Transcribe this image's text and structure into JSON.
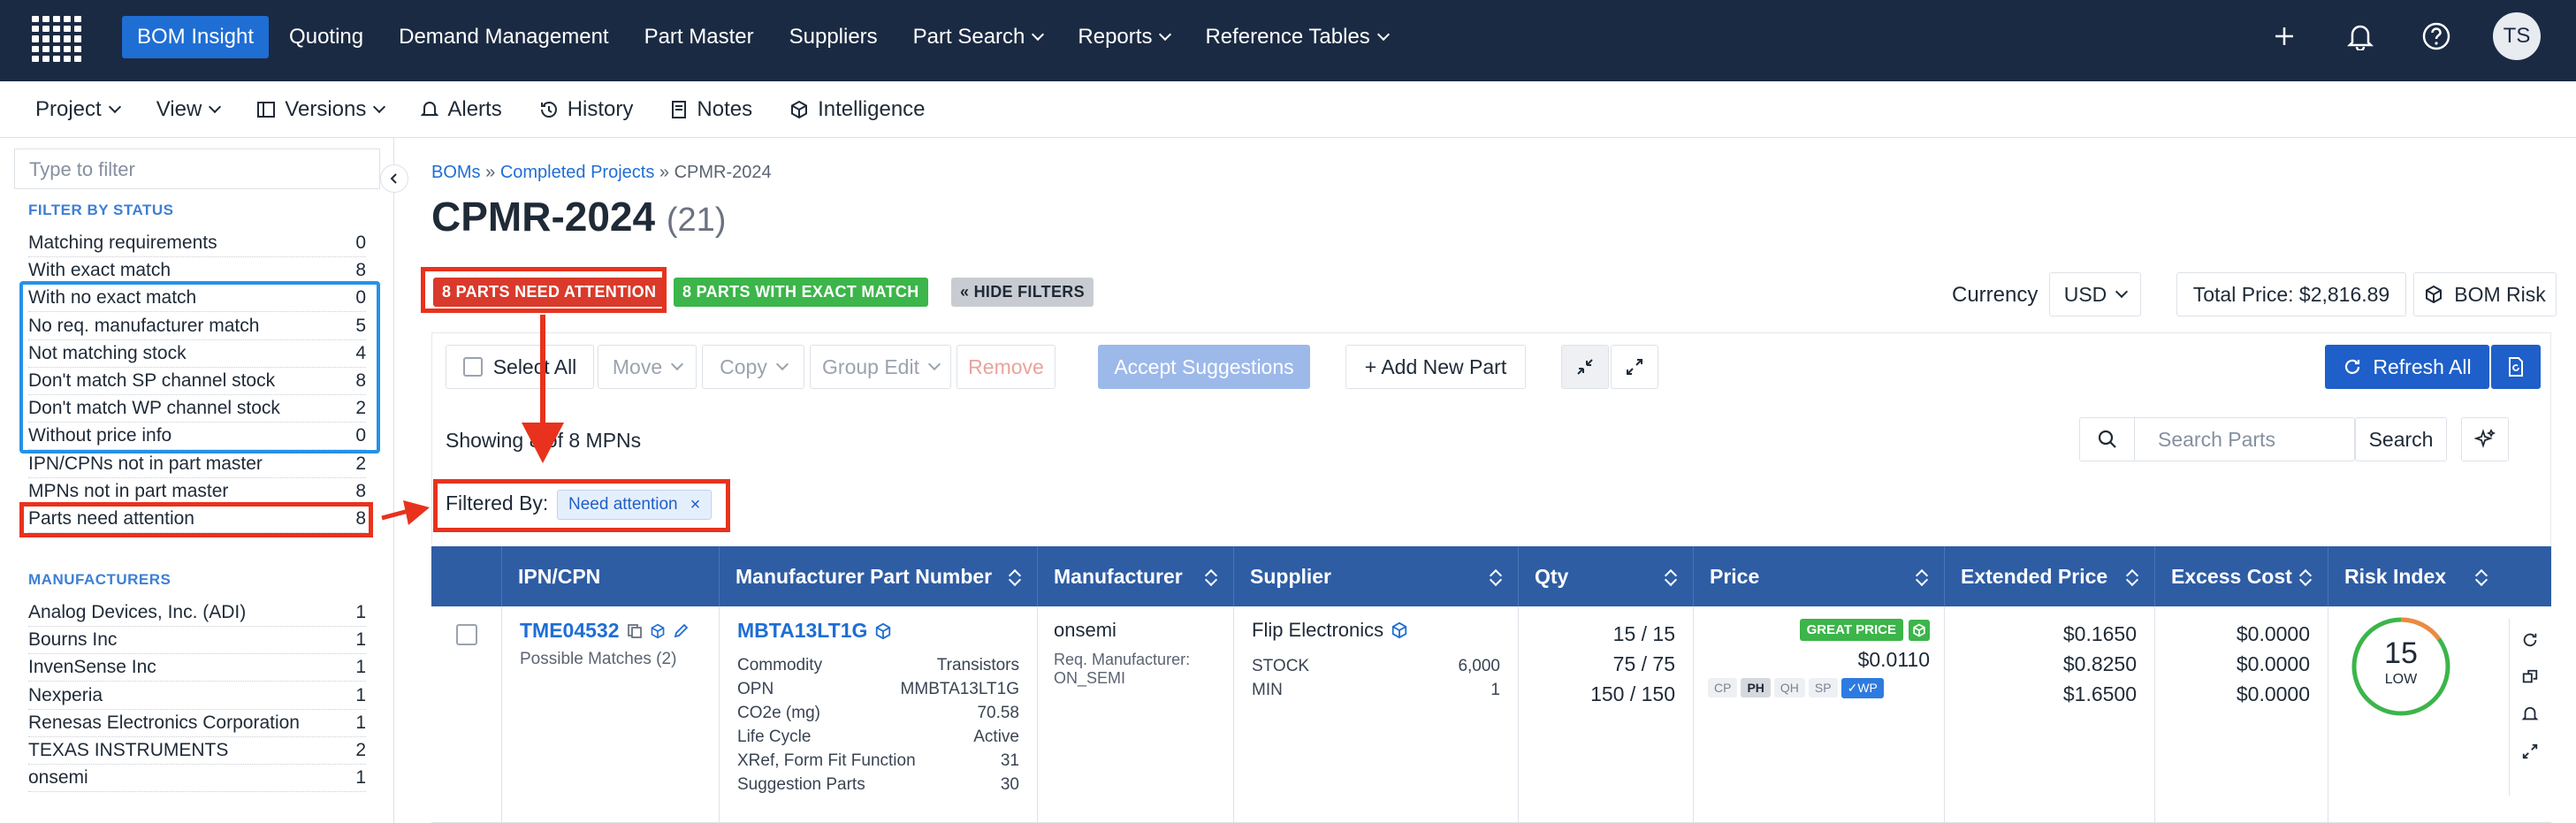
{
  "topnav": {
    "items": [
      {
        "label": "BOM Insight",
        "active": true,
        "dropdown": false
      },
      {
        "label": "Quoting",
        "active": false,
        "dropdown": false
      },
      {
        "label": "Demand Management",
        "active": false,
        "dropdown": false
      },
      {
        "label": "Part Master",
        "active": false,
        "dropdown": false
      },
      {
        "label": "Suppliers",
        "active": false,
        "dropdown": false
      },
      {
        "label": "Part Search",
        "active": false,
        "dropdown": true
      },
      {
        "label": "Reports",
        "active": false,
        "dropdown": true
      },
      {
        "label": "Reference Tables",
        "active": false,
        "dropdown": true
      }
    ],
    "avatar_initials": "TS"
  },
  "subnav": {
    "project": "Project",
    "view": "View",
    "versions": "Versions",
    "alerts": "Alerts",
    "history": "History",
    "notes": "Notes",
    "intelligence": "Intelligence"
  },
  "sidebar": {
    "filter_placeholder": "Type to filter",
    "status_heading": "FILTER BY STATUS",
    "status_items": [
      {
        "label": "Matching requirements",
        "count": "0"
      },
      {
        "label": "With exact match",
        "count": "8"
      },
      {
        "label": "With no exact match",
        "count": "0"
      },
      {
        "label": "No req. manufacturer match",
        "count": "5"
      },
      {
        "label": "Not matching stock",
        "count": "4"
      },
      {
        "label": "Don't match SP channel stock",
        "count": "8"
      },
      {
        "label": "Don't match WP channel stock",
        "count": "2"
      },
      {
        "label": "Without price info",
        "count": "0"
      },
      {
        "label": "IPN/CPNs not in part master",
        "count": "2"
      },
      {
        "label": "MPNs not in part master",
        "count": "8"
      },
      {
        "label": "Parts need attention",
        "count": "8"
      }
    ],
    "manufacturers_heading": "MANUFACTURERS",
    "manufacturers": [
      {
        "label": "Analog Devices, Inc. (ADI)",
        "count": "1"
      },
      {
        "label": "Bourns Inc",
        "count": "1"
      },
      {
        "label": "InvenSense Inc",
        "count": "1"
      },
      {
        "label": "Nexperia",
        "count": "1"
      },
      {
        "label": "Renesas Electronics Corporation",
        "count": "1"
      },
      {
        "label": "TEXAS INSTRUMENTS",
        "count": "2"
      },
      {
        "label": "onsemi",
        "count": "1"
      }
    ]
  },
  "main": {
    "breadcrumb": {
      "boms": "BOMs",
      "sep": "»",
      "projects": "Completed Projects",
      "current": "CPMR-2024"
    },
    "title": "CPMR-2024",
    "title_count": "(21)",
    "badges": {
      "attention": "8 PARTS NEED ATTENTION",
      "exact": "8 PARTS WITH EXACT MATCH",
      "hide_filters": "« HIDE FILTERS"
    },
    "currency_label": "Currency",
    "currency_value": "USD",
    "total_price": "Total Price: $2,816.89",
    "bom_risk": "BOM Risk",
    "toolbar": {
      "select_all": "Select All",
      "move": "Move",
      "copy": "Copy",
      "group_edit": "Group Edit",
      "remove": "Remove",
      "accept": "Accept Suggestions",
      "add_part": "+ Add New Part",
      "refresh_all": "Refresh All"
    },
    "showing": "Showing 8 of 8 MPNs",
    "search_placeholder": "Search Parts",
    "search_button": "Search",
    "filtered_by": "Filtered By:",
    "filter_tag": "Need attention",
    "columns": [
      "IPN/CPN",
      "Manufacturer Part Number",
      "Manufacturer",
      "Supplier",
      "Qty",
      "Price",
      "Extended Price",
      "Excess Cost",
      "Risk Index"
    ],
    "row": {
      "ipn": "TME04532",
      "possible": "Possible Matches (2)",
      "mpn": "MBTA13LT1G",
      "details": [
        {
          "k": "Commodity",
          "v": "Transistors"
        },
        {
          "k": "OPN",
          "v": "MMBTA13LT1G"
        },
        {
          "k": "CO2e (mg)",
          "v": "70.58"
        },
        {
          "k": "Life Cycle",
          "v": "Active"
        },
        {
          "k": "XRef, Form Fit Function",
          "v": "31"
        },
        {
          "k": "Suggestion Parts",
          "v": "30"
        }
      ],
      "manufacturer": "onsemi",
      "req_mfr_label": "Req. Manufacturer:",
      "req_mfr_value": "ON_SEMI",
      "supplier": "Flip Electronics",
      "stock_label": "STOCK",
      "stock_value": "6,000",
      "min_label": "MIN",
      "min_value": "1",
      "qty": [
        "15 / 15",
        "75 / 75",
        "150 / 150"
      ],
      "great_price": "GREAT PRICE",
      "price": "$0.0110",
      "channels": [
        "CP",
        "PH",
        "QH",
        "SP",
        "✓WP"
      ],
      "extended": [
        "$0.1650",
        "$0.8250",
        "$1.6500"
      ],
      "excess": [
        "$0.0000",
        "$0.0000",
        "$0.0000"
      ],
      "risk_value": "15",
      "risk_label": "LOW"
    }
  }
}
